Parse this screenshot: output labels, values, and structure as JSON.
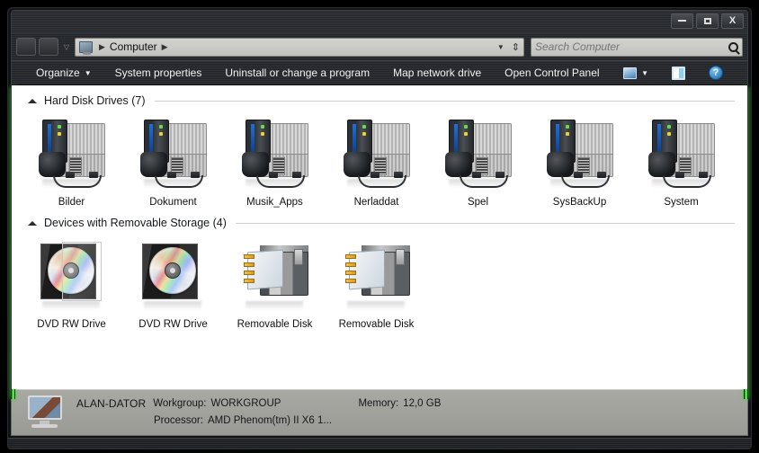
{
  "window": {
    "controls": {
      "minimize": "–",
      "maximize": "□",
      "close": "X"
    }
  },
  "address_bar": {
    "back_label": "",
    "forward_label": "",
    "history_caret": "▽",
    "computer_icon": "computer-icon",
    "crumbs": [
      "Computer"
    ],
    "separator": "▶",
    "dropdown_caret": "▼",
    "refresh_glyph": "⇕"
  },
  "search": {
    "placeholder": "Search Computer",
    "value": "",
    "icon": "search-icon"
  },
  "toolbar": {
    "organize": "Organize",
    "organize_caret": "▼",
    "system_properties": "System properties",
    "uninstall": "Uninstall or change a program",
    "map_network_drive": "Map network drive",
    "open_control_panel": "Open Control Panel",
    "views_caret": "▼",
    "help_glyph": "?"
  },
  "groups": [
    {
      "title": "Hard Disk Drives (7)",
      "collapsed": false,
      "icon_type": "hard-drive",
      "items": [
        {
          "label": "Bilder"
        },
        {
          "label": "Dokument"
        },
        {
          "label": "Musik_Apps"
        },
        {
          "label": "Nerladdat"
        },
        {
          "label": "Spel"
        },
        {
          "label": "SysBackUp"
        },
        {
          "label": "System"
        }
      ]
    },
    {
      "title": "Devices with Removable Storage (4)",
      "collapsed": false,
      "items": [
        {
          "label": "DVD RW Drive",
          "icon_type": "dvd"
        },
        {
          "label": "DVD RW Drive",
          "icon_type": "dvd"
        },
        {
          "label": "Removable Disk",
          "icon_type": "removable"
        },
        {
          "label": "Removable Disk",
          "icon_type": "removable"
        }
      ]
    }
  ],
  "details_pane": {
    "computer_name": "ALAN-DATOR",
    "workgroup_label": "Workgroup:",
    "workgroup_value": "WORKGROUP",
    "memory_label": "Memory:",
    "memory_value": "12,0 GB",
    "processor_label": "Processor:",
    "processor_value": "AMD Phenom(tm) II X6 1..."
  },
  "colors": {
    "accent_green": "#3cd82e",
    "content_bg": "#ffffff",
    "toolbar_text": "#f2f2f2",
    "details_bg": "#a9a9a4"
  }
}
